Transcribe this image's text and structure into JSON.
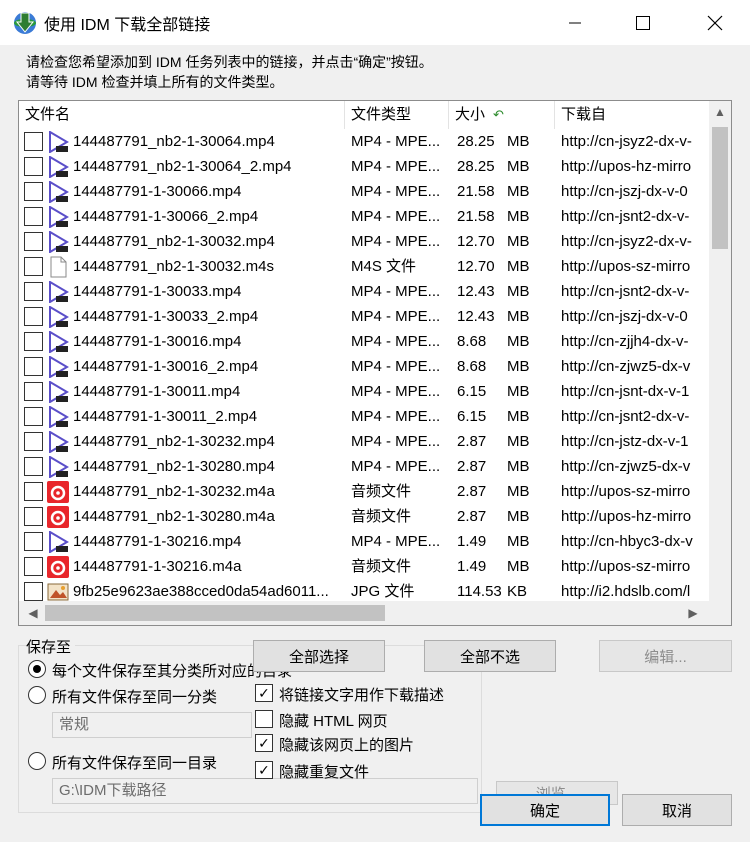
{
  "window": {
    "title": "使用 IDM 下载全部链接",
    "minimize_icon": "minimize-icon",
    "maximize_icon": "maximize-icon",
    "close_icon": "close-icon"
  },
  "instructions": {
    "line1": "请检查您希望添加到 IDM 任务列表中的链接，并点击“确定”按钮。",
    "line2": "请等待 IDM 检查并填上所有的文件类型。"
  },
  "list": {
    "columns": {
      "name": "文件名",
      "type": "文件类型",
      "size": "大小",
      "source": "下载自"
    },
    "rows": [
      {
        "icon": "video",
        "name": "144487791_nb2-1-30064.mp4",
        "type": "MP4 - MPE...",
        "size": "28.25",
        "unit": "MB",
        "source": "http://cn-jsyz2-dx-v-"
      },
      {
        "icon": "video",
        "name": "144487791_nb2-1-30064_2.mp4",
        "type": "MP4 - MPE...",
        "size": "28.25",
        "unit": "MB",
        "source": "http://upos-hz-mirro"
      },
      {
        "icon": "video",
        "name": "144487791-1-30066.mp4",
        "type": "MP4 - MPE...",
        "size": "21.58",
        "unit": "MB",
        "source": "http://cn-jszj-dx-v-0"
      },
      {
        "icon": "video",
        "name": "144487791-1-30066_2.mp4",
        "type": "MP4 - MPE...",
        "size": "21.58",
        "unit": "MB",
        "source": "http://cn-jsnt2-dx-v-"
      },
      {
        "icon": "video",
        "name": "144487791_nb2-1-30032.mp4",
        "type": "MP4 - MPE...",
        "size": "12.70",
        "unit": "MB",
        "source": "http://cn-jsyz2-dx-v-"
      },
      {
        "icon": "file",
        "name": "144487791_nb2-1-30032.m4s",
        "type": "M4S 文件",
        "size": "12.70",
        "unit": "MB",
        "source": "http://upos-sz-mirro"
      },
      {
        "icon": "video",
        "name": "144487791-1-30033.mp4",
        "type": "MP4 - MPE...",
        "size": "12.43",
        "unit": "MB",
        "source": "http://cn-jsnt2-dx-v-"
      },
      {
        "icon": "video",
        "name": "144487791-1-30033_2.mp4",
        "type": "MP4 - MPE...",
        "size": "12.43",
        "unit": "MB",
        "source": "http://cn-jszj-dx-v-0"
      },
      {
        "icon": "video",
        "name": "144487791-1-30016.mp4",
        "type": "MP4 - MPE...",
        "size": "8.68",
        "unit": "MB",
        "source": "http://cn-zjjh4-dx-v-"
      },
      {
        "icon": "video",
        "name": "144487791-1-30016_2.mp4",
        "type": "MP4 - MPE...",
        "size": "8.68",
        "unit": "MB",
        "source": "http://cn-zjwz5-dx-v"
      },
      {
        "icon": "video",
        "name": "144487791-1-30011.mp4",
        "type": "MP4 - MPE...",
        "size": "6.15",
        "unit": "MB",
        "source": "http://cn-jsnt-dx-v-1"
      },
      {
        "icon": "video",
        "name": "144487791-1-30011_2.mp4",
        "type": "MP4 - MPE...",
        "size": "6.15",
        "unit": "MB",
        "source": "http://cn-jsnt2-dx-v-"
      },
      {
        "icon": "video",
        "name": "144487791_nb2-1-30232.mp4",
        "type": "MP4 - MPE...",
        "size": "2.87",
        "unit": "MB",
        "source": "http://cn-jstz-dx-v-1"
      },
      {
        "icon": "video",
        "name": "144487791_nb2-1-30280.mp4",
        "type": "MP4 - MPE...",
        "size": "2.87",
        "unit": "MB",
        "source": "http://cn-zjwz5-dx-v"
      },
      {
        "icon": "audio",
        "name": "144487791_nb2-1-30232.m4a",
        "type": "音频文件",
        "size": "2.87",
        "unit": "MB",
        "source": "http://upos-sz-mirro"
      },
      {
        "icon": "audio",
        "name": "144487791_nb2-1-30280.m4a",
        "type": "音频文件",
        "size": "2.87",
        "unit": "MB",
        "source": "http://upos-hz-mirro"
      },
      {
        "icon": "video",
        "name": "144487791-1-30216.mp4",
        "type": "MP4 - MPE...",
        "size": "1.49",
        "unit": "MB",
        "source": "http://cn-hbyc3-dx-v"
      },
      {
        "icon": "audio",
        "name": "144487791-1-30216.m4a",
        "type": "音频文件",
        "size": "1.49",
        "unit": "MB",
        "source": "http://upos-sz-mirro"
      },
      {
        "icon": "image",
        "name": "9fb25e9623ae388cced0da54ad6011...",
        "type": "JPG 文件",
        "size": "114.53",
        "unit": "KB",
        "source": "http://i2.hdslb.com/l"
      }
    ]
  },
  "buttons": {
    "select_all": "全部选择",
    "select_none": "全部不选",
    "edit": "编辑...",
    "browse": "浏览...",
    "ok": "确定",
    "cancel": "取消"
  },
  "save": {
    "group_label": "保存至",
    "opt_by_category": "每个文件保存至其分类所对应的目录",
    "opt_same_category": "所有文件保存至同一分类",
    "category_value": "常规",
    "opt_same_dir": "所有文件保存至同一目录",
    "dir_value": "G:\\IDM下载路径"
  },
  "options": {
    "use_link_text": {
      "label": "将链接文字用作下载描述",
      "checked": true
    },
    "hide_html": {
      "label": "隐藏 HTML 网页",
      "checked": false
    },
    "hide_images": {
      "label": "隐藏该网页上的图片",
      "checked": true
    },
    "hide_duplicates": {
      "label": "隐藏重复文件",
      "checked": true
    }
  },
  "colors": {
    "video_icon": "#5b4fc9",
    "audio_icon": "#e8262b",
    "accent": "#0078d7"
  }
}
